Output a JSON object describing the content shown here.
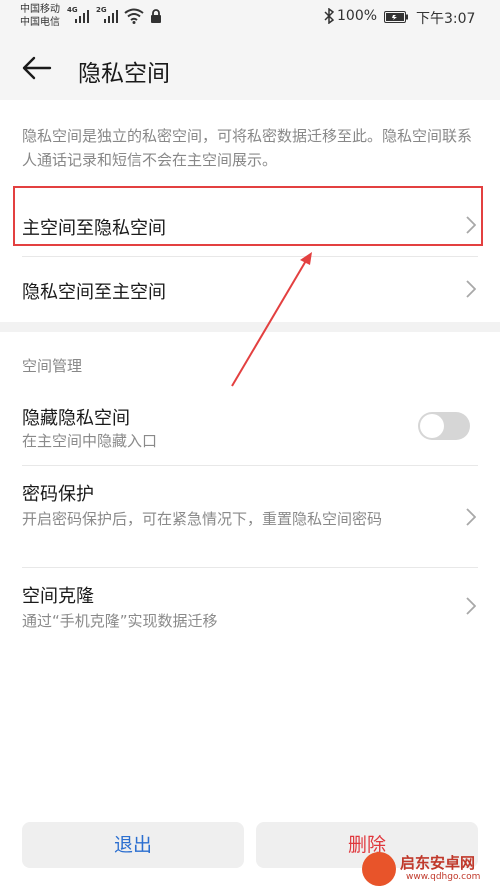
{
  "status_bar": {
    "carrier_1": "中国移动",
    "carrier_2": "中国电信",
    "net_1": "4G",
    "net_2": "2G",
    "battery": "100%",
    "time": "下午3:07"
  },
  "header": {
    "title": "隐私空间"
  },
  "description": "隐私空间是独立的私密空间，可将私密数据迁移至此。隐私空间联系人通话记录和短信不会在主空间展示。",
  "migration": {
    "to_private": "主空间至隐私空间",
    "to_main": "隐私空间至主空间"
  },
  "management": {
    "section_title": "空间管理",
    "hide": {
      "label": "隐藏隐私空间",
      "sub": "在主空间中隐藏入口",
      "enabled": false
    },
    "password": {
      "label": "密码保护",
      "sub": "开启密码保护后，可在紧急情况下，重置隐私空间密码"
    },
    "clone": {
      "label": "空间克隆",
      "sub": "通过“手机克隆”实现数据迁移"
    }
  },
  "buttons": {
    "exit": "退出",
    "delete": "删除"
  },
  "watermark": {
    "name": "启东安卓网",
    "url": "www.qdhgo.com"
  },
  "colors": {
    "accent": "#2c6fd0",
    "danger": "#e0383e",
    "highlight": "#e34040"
  }
}
